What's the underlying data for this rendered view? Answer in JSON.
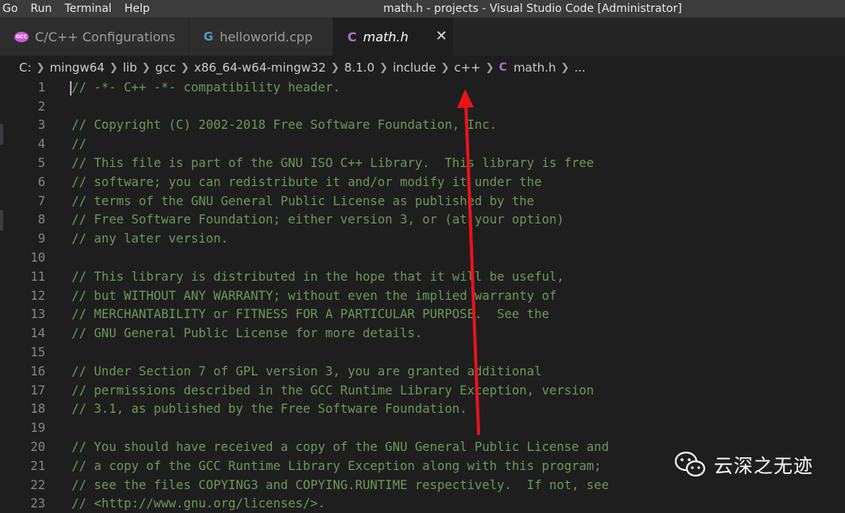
{
  "menu": [
    "Go",
    "Run",
    "Terminal",
    "Help"
  ],
  "window_title": "math.h - projects - Visual Studio Code [Administrator]",
  "tabs": [
    {
      "label": "C/C++ Configurations",
      "icon": "gcc-icon",
      "active": false
    },
    {
      "label": "helloworld.cpp",
      "icon": "cpp-icon",
      "active": false
    },
    {
      "label": "math.h",
      "icon": "c-icon",
      "active": true,
      "close": "✕"
    }
  ],
  "breadcrumb": {
    "parts": [
      "C:",
      "mingw64",
      "lib",
      "gcc",
      "x86_64-w64-mingw32",
      "8.1.0",
      "include",
      "c++"
    ],
    "file": "math.h",
    "more": "..."
  },
  "icon_glyphs": {
    "c": "C",
    "cpp": "G",
    "gcc": "GCC"
  },
  "code_lines": [
    {
      "n": "1",
      "text": "// -*- C++ -*- compatibility header."
    },
    {
      "n": "2",
      "text": ""
    },
    {
      "n": "3",
      "text": "// Copyright (C) 2002-2018 Free Software Foundation, Inc."
    },
    {
      "n": "4",
      "text": "//"
    },
    {
      "n": "5",
      "text": "// This file is part of the GNU ISO C++ Library.  This library is free"
    },
    {
      "n": "6",
      "text": "// software; you can redistribute it and/or modify it under the"
    },
    {
      "n": "7",
      "text": "// terms of the GNU General Public License as published by the"
    },
    {
      "n": "8",
      "text": "// Free Software Foundation; either version 3, or (at your option)"
    },
    {
      "n": "9",
      "text": "// any later version."
    },
    {
      "n": "10",
      "text": ""
    },
    {
      "n": "11",
      "text": "// This library is distributed in the hope that it will be useful,"
    },
    {
      "n": "12",
      "text": "// but WITHOUT ANY WARRANTY; without even the implied warranty of"
    },
    {
      "n": "13",
      "text": "// MERCHANTABILITY or FITNESS FOR A PARTICULAR PURPOSE.  See the"
    },
    {
      "n": "14",
      "text": "// GNU General Public License for more details."
    },
    {
      "n": "15",
      "text": ""
    },
    {
      "n": "16",
      "text": "// Under Section 7 of GPL version 3, you are granted additional"
    },
    {
      "n": "17",
      "text": "// permissions described in the GCC Runtime Library Exception, version"
    },
    {
      "n": "18",
      "text": "// 3.1, as published by the Free Software Foundation."
    },
    {
      "n": "19",
      "text": ""
    },
    {
      "n": "20",
      "text": "// You should have received a copy of the GNU General Public License and"
    },
    {
      "n": "21",
      "text": "// a copy of the GCC Runtime Library Exception along with this program;"
    },
    {
      "n": "22",
      "text": "// see the files COPYING3 and COPYING.RUNTIME respectively.  If not, see"
    },
    {
      "n": "23",
      "text": "// <http://www.gnu.org/licenses/>."
    }
  ],
  "colors": {
    "comment": "#6a9955",
    "line_number": "#858585",
    "arrow": "#e8141c"
  },
  "watermark": {
    "text": "云深之无迹",
    "icon": "wechat-icon"
  }
}
